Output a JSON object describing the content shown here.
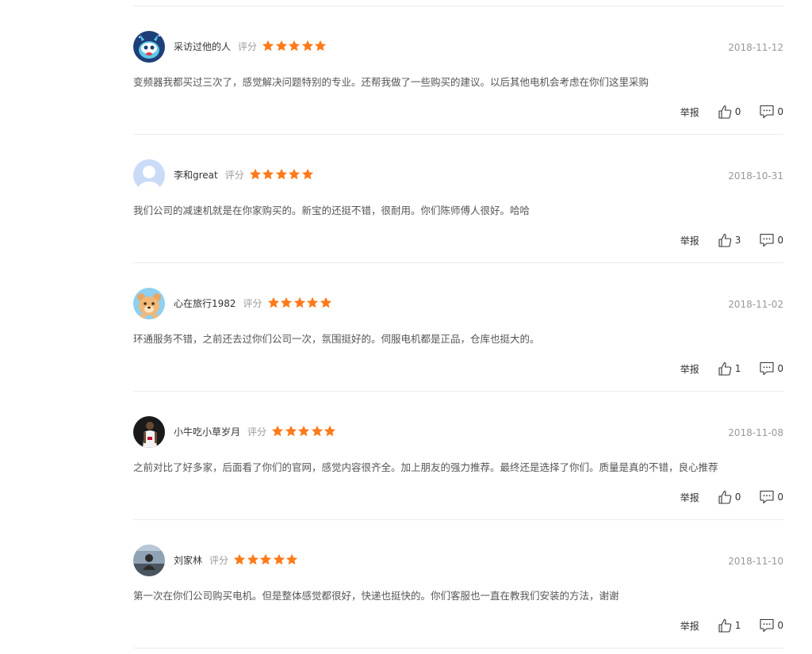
{
  "score_label": "评分",
  "report_label": "举报",
  "star_color": "#ff7a1a",
  "reviews": [
    {
      "user": "采访过他的人",
      "rating": 5,
      "date": "2018-11-12",
      "content": "变频器我都买过三次了，感觉解决问题特别的专业。还帮我做了一些购买的建议。以后其他电机会考虑在你们这里采购",
      "likes": "0",
      "replies": "0",
      "avatar": "rabbit-avatar"
    },
    {
      "user": "李和great",
      "rating": 5,
      "date": "2018-10-31",
      "content": "我们公司的减速机就是在你家购买的。新宝的还挺不错，很耐用。你们陈师傅人很好。哈哈",
      "likes": "3",
      "replies": "0",
      "avatar": "default-avatar"
    },
    {
      "user": "心在旅行1982",
      "rating": 5,
      "date": "2018-11-02",
      "content": "环通服务不错，之前还去过你们公司一次，氛围挺好的。伺服电机都是正品，仓库也挺大的。",
      "likes": "1",
      "replies": "0",
      "avatar": "bear-avatar"
    },
    {
      "user": "小牛吃小草岁月",
      "rating": 5,
      "date": "2018-11-08",
      "content": "之前对比了好多家，后面看了你们的官网，感觉内容很齐全。加上朋友的强力推荐。最终还是选择了你们。质量是真的不错，良心推荐",
      "likes": "0",
      "replies": "0",
      "avatar": "basketball-avatar"
    },
    {
      "user": "刘家林",
      "rating": 5,
      "date": "2018-11-10",
      "content": "第一次在你们公司购买电机。但是整体感觉都很好，快递也挺快的。你们客服也一直在教我们安装的方法，谢谢",
      "likes": "1",
      "replies": "0",
      "avatar": "photo-avatar"
    }
  ]
}
